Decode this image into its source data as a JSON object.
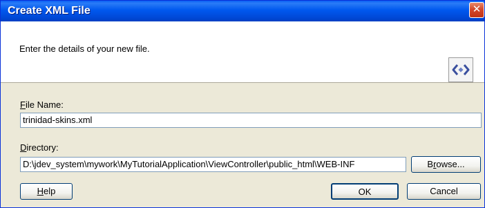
{
  "window": {
    "title": "Create XML File",
    "close_glyph": "✕"
  },
  "header": {
    "text": "Enter the details of your new file.",
    "icon": "xml-file-icon"
  },
  "file_name": {
    "label_mnemonic": "F",
    "label_rest": "ile Name:",
    "value": "trinidad-skins.xml"
  },
  "directory": {
    "label_mnemonic": "D",
    "label_rest": "irectory:",
    "value": "D:\\jdev_system\\mywork\\MyTutorialApplication\\ViewController\\public_html\\WEB-INF"
  },
  "buttons": {
    "browse": {
      "mnemonic_pre": "B",
      "mnemonic": "r",
      "rest": "owse..."
    },
    "help": {
      "mnemonic": "H",
      "rest": "elp"
    },
    "ok": "OK",
    "cancel": "Cancel"
  },
  "colors": {
    "title_bar": "#0058ee",
    "dialog_bg": "#ece9d8",
    "close": "#d4482b"
  }
}
